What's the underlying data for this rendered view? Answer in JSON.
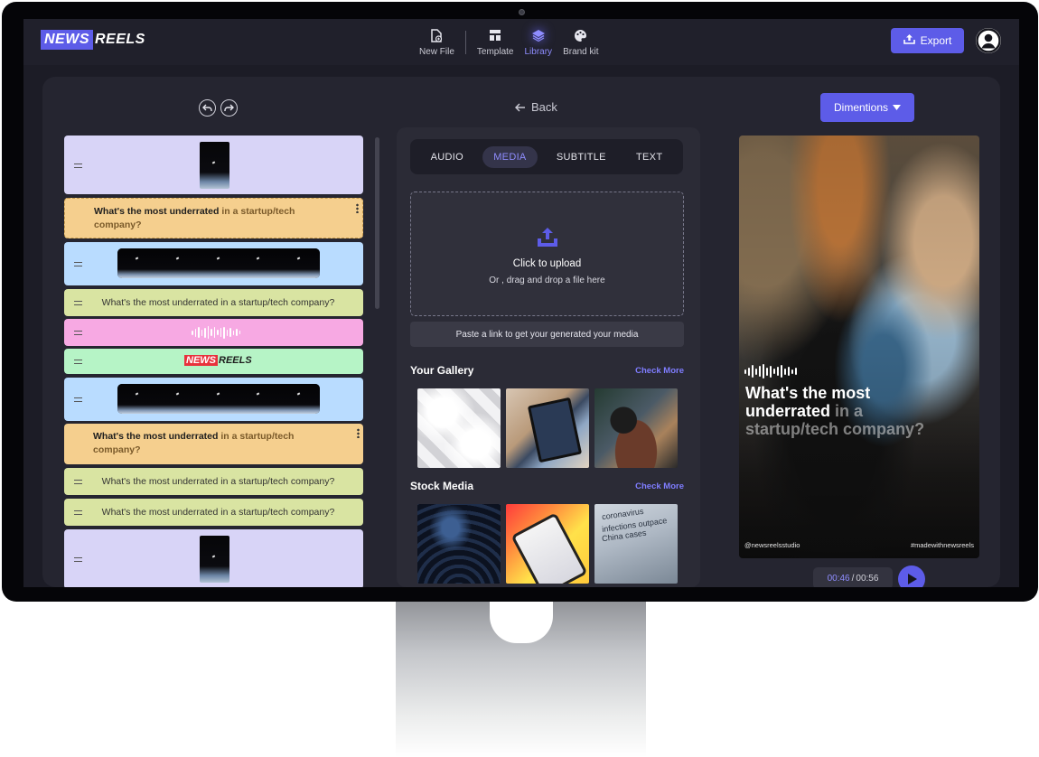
{
  "brand": {
    "part1": "NEWS",
    "part2": "REELS"
  },
  "nav": {
    "tabs": [
      {
        "label": "New File",
        "icon": "new-file-icon"
      },
      {
        "label": "Template",
        "icon": "template-icon"
      },
      {
        "label": "Library",
        "icon": "library-icon",
        "active": true
      },
      {
        "label": "Brand kit",
        "icon": "palette-icon"
      }
    ],
    "export_label": "Export"
  },
  "toolbar": {
    "back_label": "Back",
    "dimensions_label": "Dimentions"
  },
  "timeline": {
    "question": "What's the most underrated in a startup/tech company?",
    "question_bold": "What's the most underrated",
    "question_rest": "in a startup/tech",
    "question_end": "company?",
    "logo_part1": "NEWS",
    "logo_part2": "REELS",
    "colors": {
      "video": "#d8d4f7",
      "question_card": "#f5cf8e",
      "film": "#b9dcff",
      "text": "#d9e4a2",
      "audio": "#f7a9e3",
      "logo": "#b6f4c6"
    }
  },
  "library": {
    "tabs": [
      "AUDIO",
      "MEDIA",
      "SUBTITLE",
      "TEXT"
    ],
    "active_tab": "MEDIA",
    "upload_title": "Click to upload",
    "upload_subtitle": "Or , drag and drop a file here",
    "paste_link_label": "Paste a link to get your generated your media",
    "gallery_title": "Your Gallery",
    "stock_title": "Stock Media",
    "check_more": "Check More",
    "stock_caption": [
      "coronavirus",
      "infections outpace",
      "China cases"
    ]
  },
  "preview": {
    "headline_white": "What's the most underrated",
    "headline_faded": "in a",
    "headline_white2": "startup/tech",
    "headline_faded2": "company?",
    "handle_left": "@newsreelsstudio",
    "handle_right": "#madewithnewsreels",
    "time_current": "00:46",
    "time_separator": "/",
    "time_total": "00:56"
  },
  "colors": {
    "accent": "#5d5ce8",
    "accent_text": "#8f8dff",
    "background": "#1c1c26"
  }
}
